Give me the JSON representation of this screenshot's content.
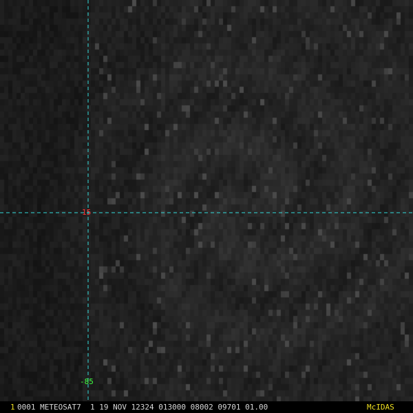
{
  "colors": {
    "grid": "#33dddd",
    "lat_label": "#ff3030",
    "lon_label": "#40ff40",
    "frame_number": "#f0e020",
    "status_text": "#d8d8d8",
    "brand": "#f0e020"
  },
  "overlay": {
    "latitude_label": "15",
    "longitude_label": "-85"
  },
  "status_bar": {
    "frame_number": "1",
    "text": "0001 METEOSAT7  1 19 NOV 12324 013000 08002 09701 01.00",
    "brand": "McIDAS"
  }
}
